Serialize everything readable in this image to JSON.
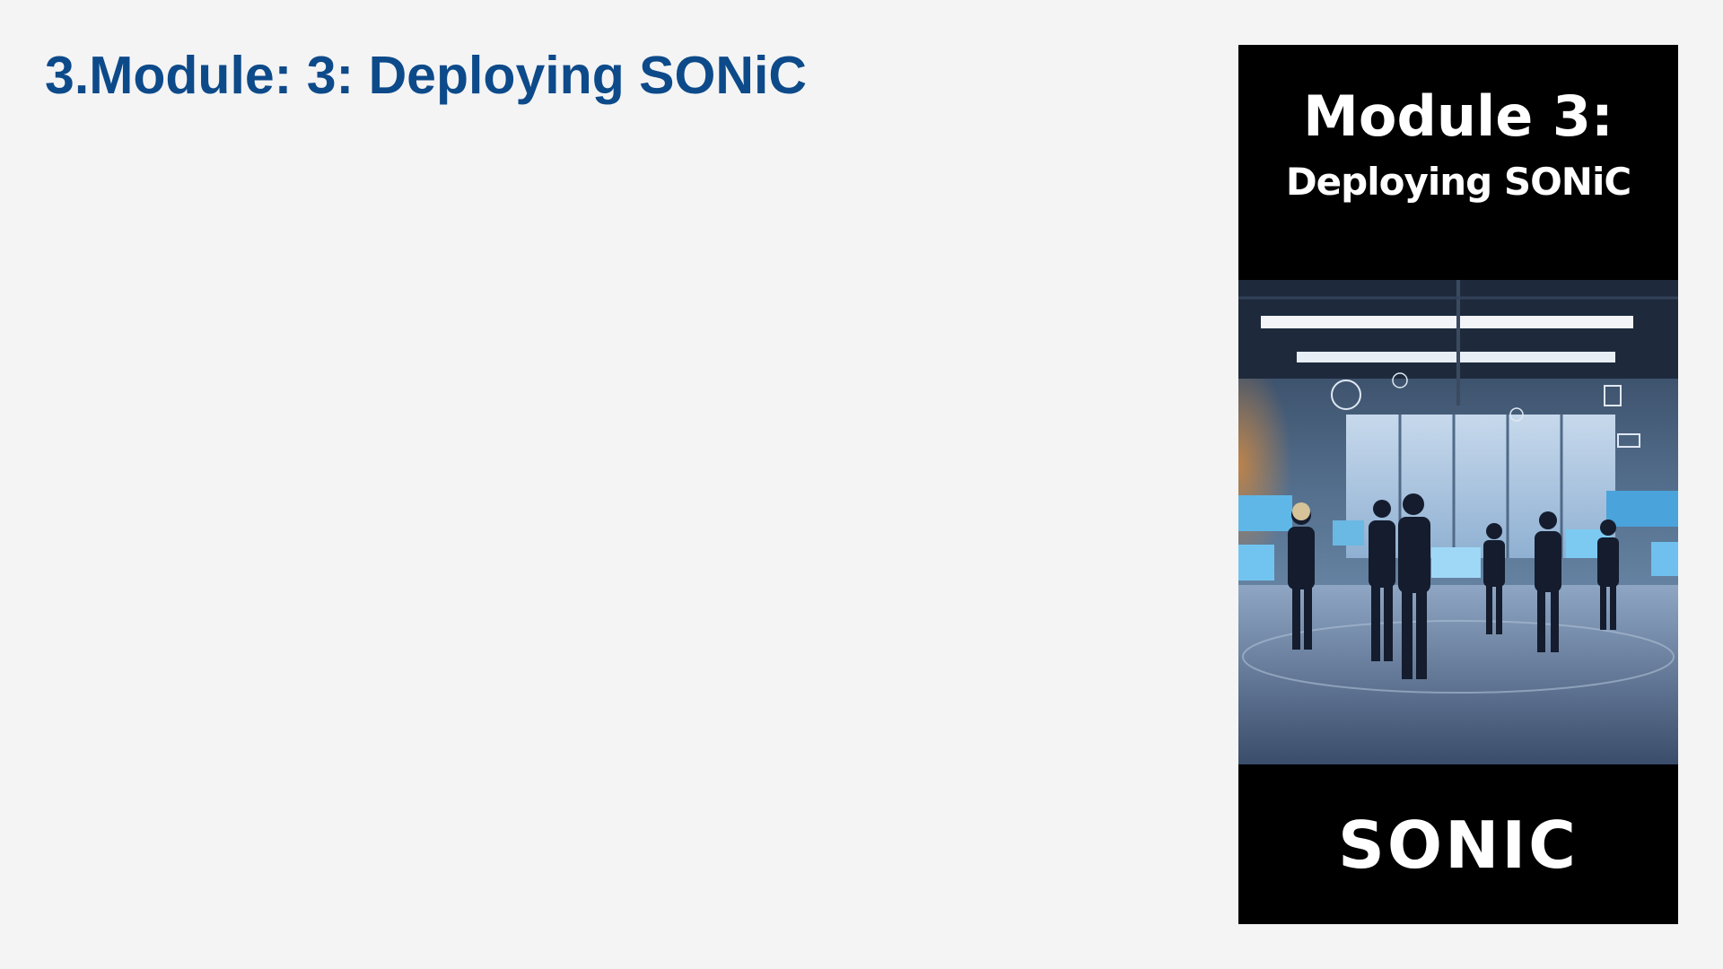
{
  "slide": {
    "title": "3.Module: 3: Deploying SONiC"
  },
  "cover": {
    "heading": "Module 3:",
    "subheading": "Deploying SONiC",
    "brand": "SONIC",
    "photo_icon": "office-team-photo"
  },
  "colors": {
    "background": "#f4f4f4",
    "title": "#0d4a8a",
    "cover_background": "#000000",
    "cover_text": "#ffffff"
  }
}
